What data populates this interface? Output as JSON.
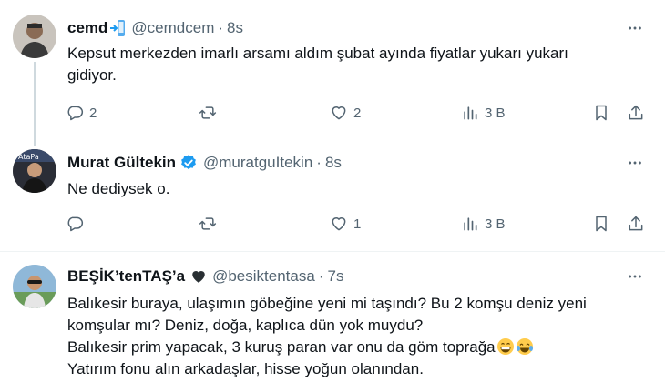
{
  "tweets": [
    {
      "name": "cemd",
      "handle": "@cemdcem",
      "separator": "·",
      "time": "8s",
      "lines": [
        "Kepsut merkezden imarlı arsamı aldım şubat ayında fiyatlar yukarı yukarı",
        "gidiyor."
      ],
      "replies": "2",
      "retweets": "",
      "likes": "2",
      "views": "3 B"
    },
    {
      "name": "Murat Gültekin",
      "handle": "@muratguItekin",
      "separator": "·",
      "time": "8s",
      "lines": [
        "Ne dediysek o."
      ],
      "replies": "",
      "retweets": "",
      "likes": "1",
      "views": "3 B"
    },
    {
      "name": "BEŞİK’tenTAŞ’a",
      "handle": "@besiktentasa",
      "separator": "·",
      "time": "7s",
      "lines": [
        "Balıkesir buraya, ulaşımın göbeğine yeni mi taşındı? Bu 2 komşu deniz yeni",
        "komşular mı? Deniz, doğa, kaplıca dün yok muydu?",
        "Balıkesir prim yapacak, 3 kuruş paran var onu da göm toprağa",
        "Yatırım fonu alın arkadaşlar, hisse yoğun olanından."
      ]
    }
  ],
  "colors": {
    "text": "#0f1419",
    "secondary": "#536471",
    "verified": "#1d9bf0",
    "divider": "#eff3f4",
    "thread_line": "#cfd9de"
  },
  "icons": [
    "reply-icon",
    "retweet-icon",
    "like-icon",
    "views-icon",
    "bookmark-icon",
    "share-icon",
    "more-icon",
    "verified-badge-icon",
    "mobile-phone-emoji",
    "black-heart-emoji",
    "grin-emoji",
    "tears-of-joy-emoji"
  ]
}
